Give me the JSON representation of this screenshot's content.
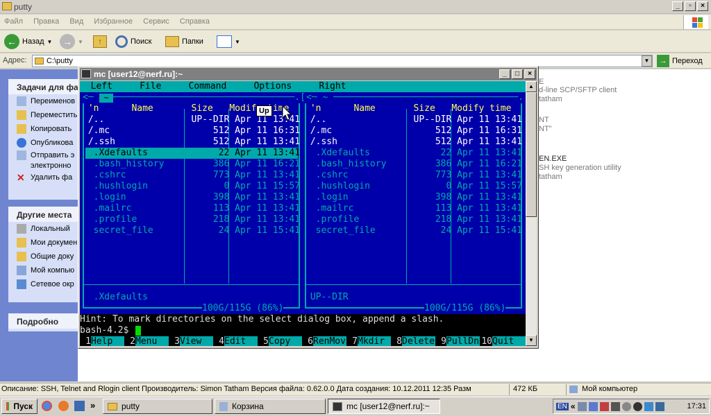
{
  "explorer": {
    "title": "putty",
    "menu": [
      "Файл",
      "Правка",
      "Вид",
      "Избранное",
      "Сервис",
      "Справка"
    ],
    "toolbar": {
      "back": "Назад",
      "search": "Поиск",
      "folders": "Папки"
    },
    "address_label": "Адрес:",
    "address_value": "C:\\putty",
    "go_label": "Переход",
    "tasks_title": "Задачи для фа",
    "tasks": [
      "Переименов",
      "Переместить",
      "Копировать",
      "Опубликова",
      "Отправить э",
      "электронно",
      "Удалить фа"
    ],
    "places_title": "Другие места",
    "places": [
      "Локальный",
      "Мои докумен",
      "Общие доку",
      "Мой компью",
      "Сетевое окр"
    ],
    "details_title": "Подробно",
    "right_snippets": [
      "E",
      "d-line SCP/SFTP client",
      "tatham",
      "NT",
      "NT\"",
      "EN.EXE",
      "SH key generation utility",
      "tatham"
    ]
  },
  "status": {
    "description": "Описание: SSH, Telnet and Rlogin client Производитель: Simon Tatham Версия файла: 0.62.0.0 Дата создания: 10.12.2011 12:35 Разм",
    "size": "472 КБ",
    "location": "Мой компьютер"
  },
  "taskbar": {
    "start": "Пуск",
    "tasks": [
      "putty",
      "Корзина",
      "mc [user12@nerf.ru]:~"
    ],
    "lang": "EN",
    "clock": "17:31"
  },
  "putty": {
    "title": "mc [user12@nerf.ru]:~",
    "menubar": "  Left     File     Command     Options     Right",
    "left_header_top": "<─ ~ ──────────────────────────────────.[^]>",
    "right_header_top": "<─ ~ ──────────────────────────────────.[^]>",
    "col_header": " 'n      Name       Size   Modify time",
    "left_rows": [
      " /..                UP--DIR Apr 11 13:41",
      " /.mc                   512 Apr 11 16:31",
      " /.ssh                  512 Apr 11 13:41",
      "  .Xdefaults             22 Apr 11 13:41",
      "  .bash_history         386 Apr 11 16:21",
      "  .cshrc                773 Apr 11 13:41",
      "  .hushlogin              0 Apr 11 15:57",
      "  .login                398 Apr 11 13:41",
      "  .mailrc               113 Apr 11 13:41",
      "  .profile              218 Apr 11 13:41",
      "  secret_file            24 Apr 11 15:41"
    ],
    "right_rows": [
      " /..                UP--DIR Apr 11 13:41",
      " /.mc                   512 Apr 11 16:31",
      " /.ssh                  512 Apr 11 13:41",
      "  .Xdefaults             22 Apr 11 13:41",
      "  .bash_history         386 Apr 11 16:21",
      "  .cshrc                773 Apr 11 13:41",
      "  .hushlogin              0 Apr 11 15:57",
      "  .login                398 Apr 11 13:41",
      "  .mailrc               113 Apr 11 13:41",
      "  .profile              218 Apr 11 13:41",
      "  secret_file            24 Apr 11 15:41"
    ],
    "left_mini": "  .Xdefaults",
    "right_mini": " UP--DIR",
    "disk_info": "100G/115G (86%)",
    "hint": "Hint: To mark directories on the select dialog box, append a slash.",
    "prompt": "bash-4.2$ ",
    "fkeys": [
      {
        "num": "1",
        "label": "Help"
      },
      {
        "num": "2",
        "label": "Menu"
      },
      {
        "num": "3",
        "label": "View"
      },
      {
        "num": "4",
        "label": "Edit"
      },
      {
        "num": "5",
        "label": "Copy"
      },
      {
        "num": "6",
        "label": "RenMov"
      },
      {
        "num": "7",
        "label": "Mkdir"
      },
      {
        "num": "8",
        "label": "Delete"
      },
      {
        "num": "9",
        "label": "PullDn"
      },
      {
        "num": "10",
        "label": "Quit"
      }
    ],
    "tooltip": "Up"
  },
  "colors": {
    "mc_blue": "#0000aa",
    "mc_cyan": "#00aaaa",
    "mc_text": "#00aaaa",
    "mc_white": "#ffffff",
    "mc_yellow": "#ffff55"
  }
}
